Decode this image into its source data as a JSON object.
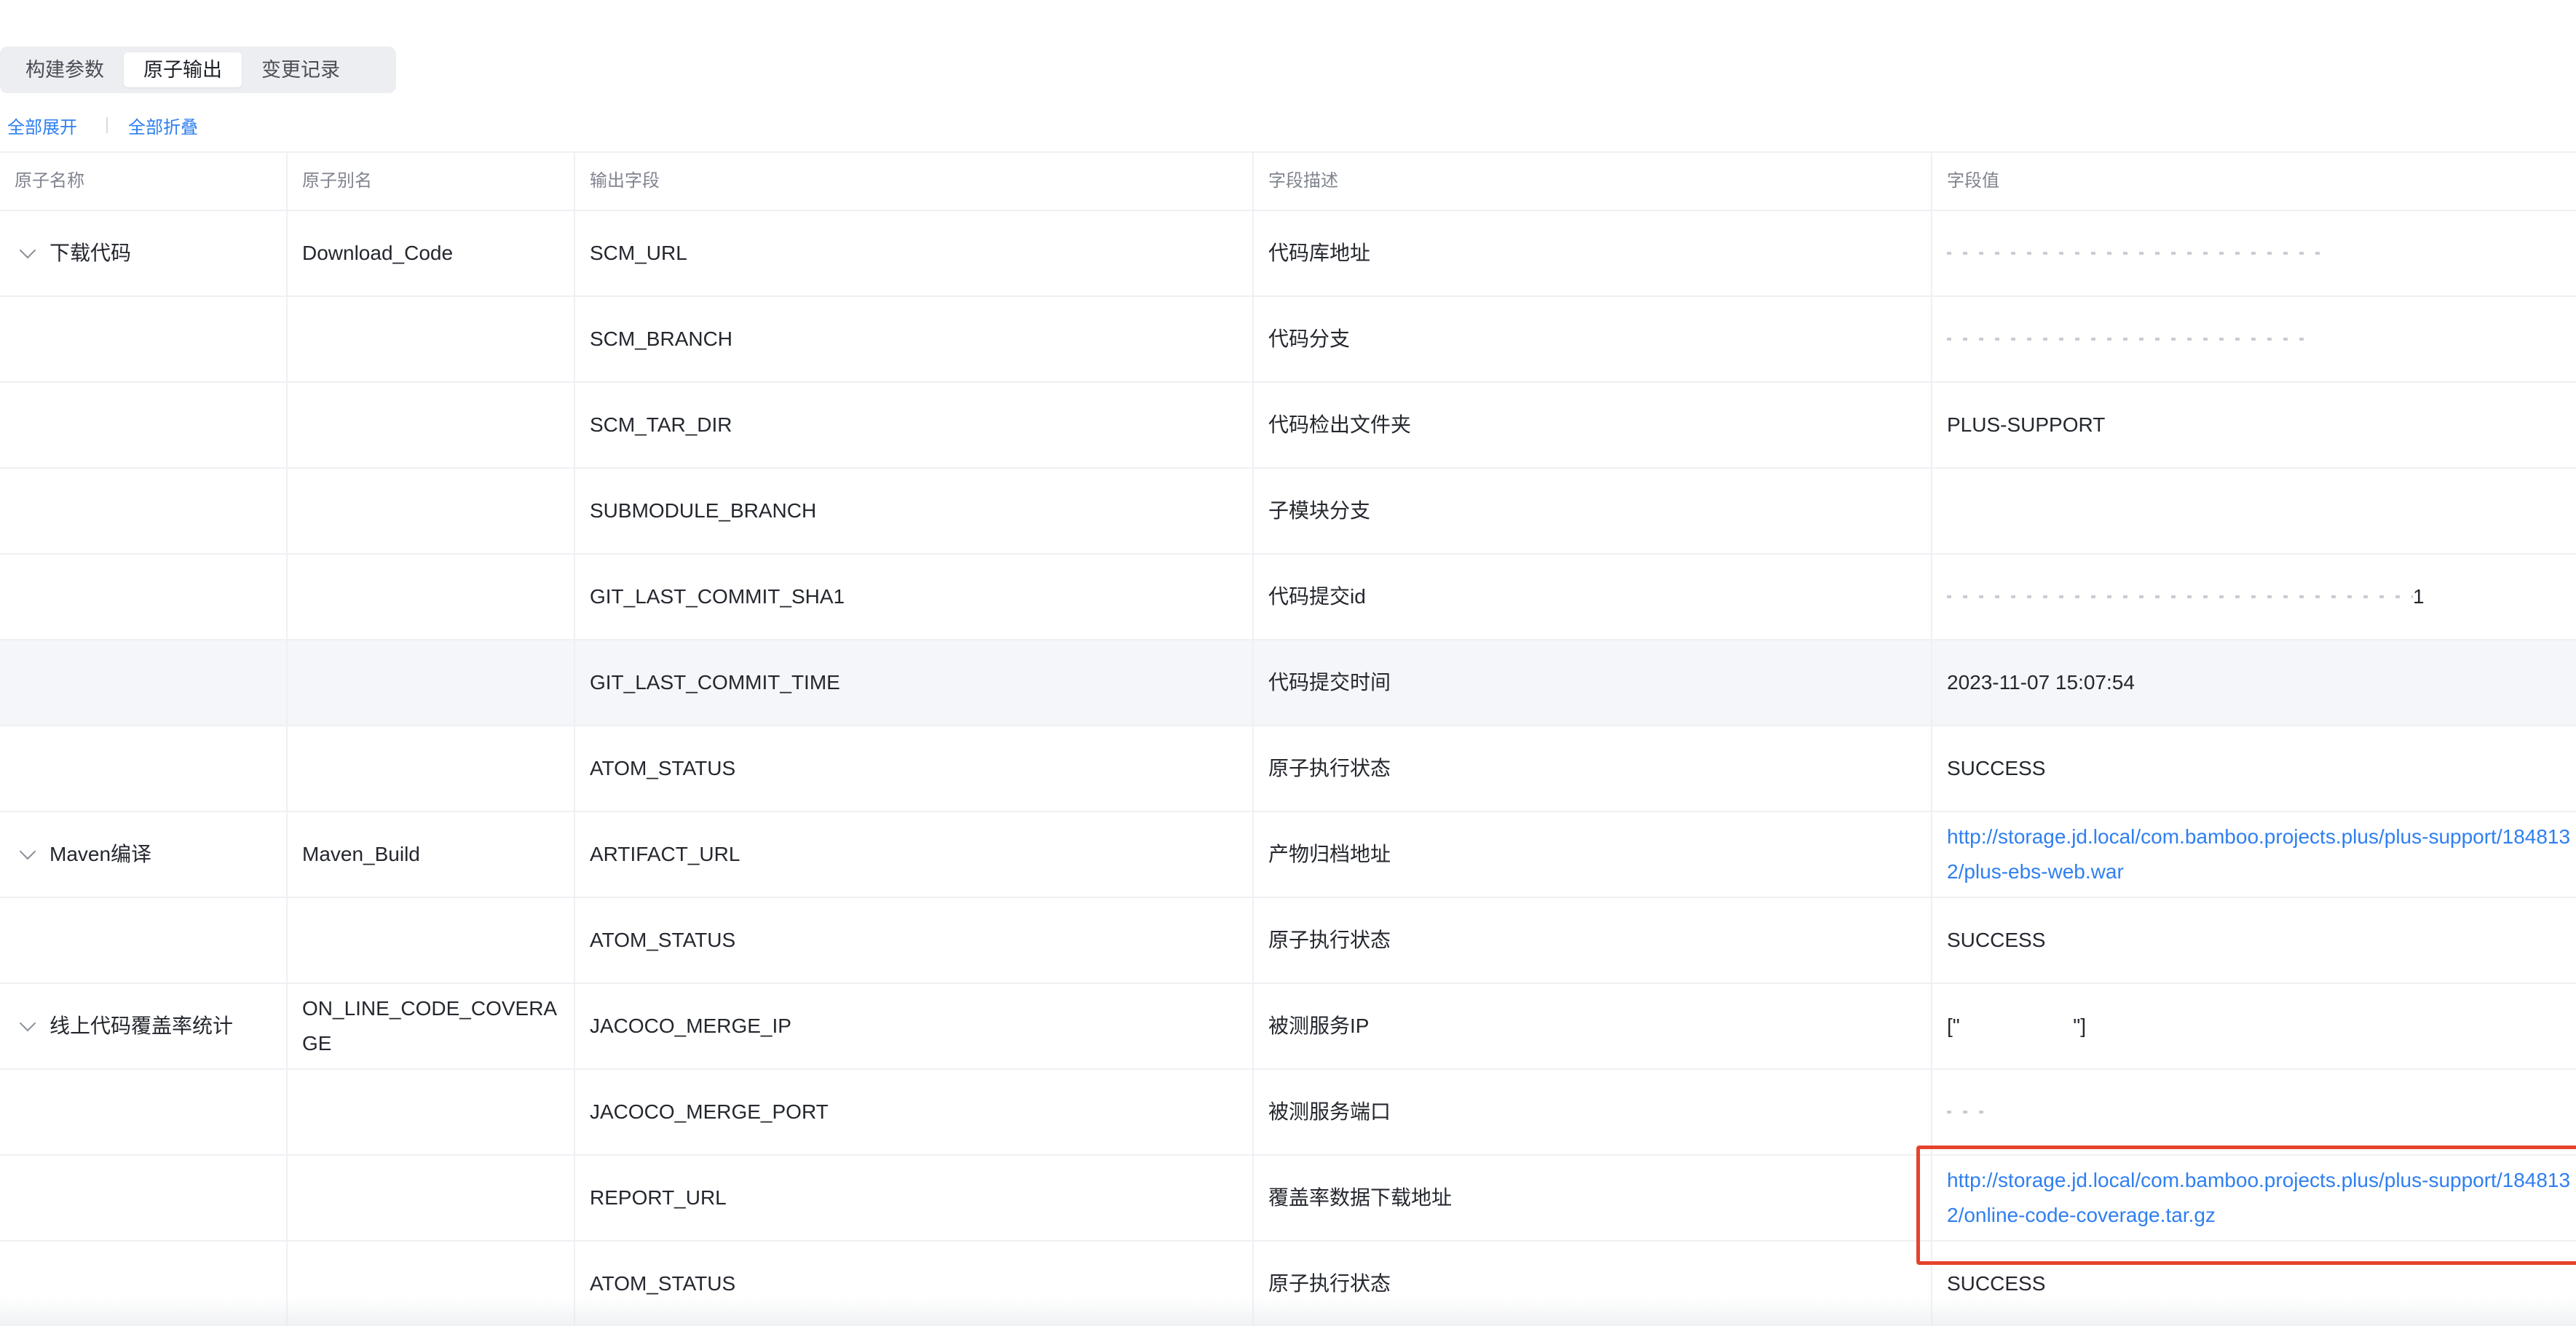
{
  "tabs": [
    {
      "label": "构建参数",
      "active": false
    },
    {
      "label": "原子输出",
      "active": true
    },
    {
      "label": "变更记录",
      "active": false
    }
  ],
  "actions": {
    "expand_all": "全部展开",
    "collapse_all": "全部折叠"
  },
  "table": {
    "headers": [
      "原子名称",
      "原子别名",
      "输出字段",
      "字段描述",
      "字段值"
    ],
    "rows": [
      {
        "atom_name": "下载代码",
        "alias": "Download_Code",
        "field": "SCM_URL",
        "desc": "代码库地址",
        "value": "",
        "masked": true
      },
      {
        "atom_name": "",
        "alias": "",
        "field": "SCM_BRANCH",
        "desc": "代码分支",
        "value": "",
        "masked": true
      },
      {
        "atom_name": "",
        "alias": "",
        "field": "SCM_TAR_DIR",
        "desc": "代码检出文件夹",
        "value": "PLUS-SUPPORT"
      },
      {
        "atom_name": "",
        "alias": "",
        "field": "SUBMODULE_BRANCH",
        "desc": "子模块分支",
        "value": ""
      },
      {
        "atom_name": "",
        "alias": "",
        "field": "GIT_LAST_COMMIT_SHA1",
        "desc": "代码提交id",
        "value": "1",
        "masked": true
      },
      {
        "atom_name": "",
        "alias": "",
        "field": "GIT_LAST_COMMIT_TIME",
        "desc": "代码提交时间",
        "value": "2023-11-07 15:07:54"
      },
      {
        "atom_name": "",
        "alias": "",
        "field": "ATOM_STATUS",
        "desc": "原子执行状态",
        "value": "SUCCESS"
      },
      {
        "atom_name": "Maven编译",
        "alias": "Maven_Build",
        "field": "ARTIFACT_URL",
        "desc": "产物归档地址",
        "value": "http://storage.jd.local/com.bamboo.projects.plus/plus-support/1848132/plus-ebs-web.war",
        "link": true
      },
      {
        "atom_name": "",
        "alias": "",
        "field": "ATOM_STATUS",
        "desc": "原子执行状态",
        "value": "SUCCESS"
      },
      {
        "atom_name": "线上代码覆盖率统计",
        "alias": "ON_LINE_CODE_COVERAGE",
        "field": "JACOCO_MERGE_IP",
        "desc": "被测服务IP",
        "value": "[\"                    \"]"
      },
      {
        "atom_name": "",
        "alias": "",
        "field": "JACOCO_MERGE_PORT",
        "desc": "被测服务端口",
        "value": "",
        "masked": true
      },
      {
        "atom_name": "",
        "alias": "",
        "field": "REPORT_URL",
        "desc": "覆盖率数据下载地址",
        "value": "http://storage.jd.local/com.bamboo.projects.plus/plus-support/1848132/online-code-coverage.tar.gz",
        "link": true
      },
      {
        "atom_name": "",
        "alias": "",
        "field": "ATOM_STATUS",
        "desc": "原子执行状态",
        "value": "SUCCESS"
      }
    ]
  },
  "colors": {
    "link": "#2f7ff0",
    "highlight_border": "#e5432c",
    "tab_bg": "#eceef2"
  },
  "icons": {
    "row_toggle": "chevron-down-icon"
  }
}
